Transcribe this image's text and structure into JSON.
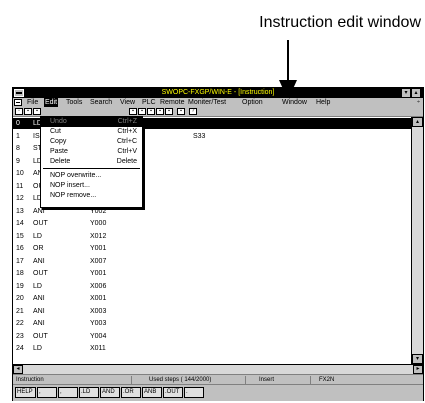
{
  "callout": {
    "label": "Instruction edit window"
  },
  "window": {
    "title": "SWOPC-FXGP/WIN-E - [Instruction]",
    "sys_menu_icon": "minus-icon",
    "title_buttons": [
      "▾",
      "▴"
    ]
  },
  "menubar": {
    "items": [
      "File",
      "Edit",
      "Tools",
      "Search",
      "View",
      "PLC",
      "Remote",
      "Moniter/Test",
      "Option",
      "Window",
      "Help"
    ],
    "active": "Edit",
    "restore_button": "÷"
  },
  "toolbar": {
    "icons": [
      "new-file-icon",
      "open-file-icon",
      "save-icon",
      "ladder-view-icon",
      "list-view-icon",
      "sfc-view-icon",
      "comment-view-icon",
      "monitor-icon",
      "zoom-icon",
      "help-icon"
    ]
  },
  "program": {
    "rows": [
      {
        "line": "0",
        "instr": "LD",
        "operand": "",
        "operand2": ""
      },
      {
        "line": "1",
        "instr": "IS",
        "operand": "S20",
        "operand2": "S33"
      },
      {
        "line": "8",
        "instr": "ST",
        "operand": "",
        "operand2": ""
      },
      {
        "line": "9",
        "instr": "LD",
        "operand": "",
        "operand2": ""
      },
      {
        "line": "10",
        "instr": "AN",
        "operand": "",
        "operand2": ""
      },
      {
        "line": "11",
        "instr": "OU",
        "operand": "",
        "operand2": ""
      },
      {
        "line": "12",
        "instr": "LD",
        "operand": "X010",
        "operand2": ""
      },
      {
        "line": "13",
        "instr": "ANI",
        "operand": "Y002",
        "operand2": ""
      },
      {
        "line": "14",
        "instr": "OUT",
        "operand": "Y000",
        "operand2": ""
      },
      {
        "line": "15",
        "instr": "LD",
        "operand": "X012",
        "operand2": ""
      },
      {
        "line": "16",
        "instr": "OR",
        "operand": "Y001",
        "operand2": ""
      },
      {
        "line": "17",
        "instr": "ANI",
        "operand": "X007",
        "operand2": ""
      },
      {
        "line": "18",
        "instr": "OUT",
        "operand": "Y001",
        "operand2": ""
      },
      {
        "line": "19",
        "instr": "LD",
        "operand": "X006",
        "operand2": ""
      },
      {
        "line": "20",
        "instr": "ANI",
        "operand": "X001",
        "operand2": ""
      },
      {
        "line": "21",
        "instr": "ANI",
        "operand": "X003",
        "operand2": ""
      },
      {
        "line": "22",
        "instr": "ANI",
        "operand": "Y003",
        "operand2": ""
      },
      {
        "line": "23",
        "instr": "OUT",
        "operand": "Y004",
        "operand2": ""
      },
      {
        "line": "24",
        "instr": "LD",
        "operand": "X011",
        "operand2": ""
      }
    ],
    "selected_index": 0
  },
  "edit_menu": {
    "items": [
      {
        "label": "Undo",
        "shortcut": "Ctrl+Z",
        "state": "highlighted"
      },
      {
        "label": "Cut",
        "shortcut": "Ctrl+X",
        "state": "enabled"
      },
      {
        "label": "Copy",
        "shortcut": "Ctrl+C",
        "state": "enabled"
      },
      {
        "label": "Paste",
        "shortcut": "Ctrl+V",
        "state": "enabled"
      },
      {
        "label": "Delete",
        "shortcut": "Delete",
        "state": "enabled"
      },
      {
        "label": "NOP overwrite...",
        "shortcut": "",
        "state": "enabled"
      },
      {
        "label": "NOP insert...",
        "shortcut": "",
        "state": "enabled"
      },
      {
        "label": "NOP remove...",
        "shortcut": "",
        "state": "enabled"
      }
    ]
  },
  "scrollbars": {
    "up": "▴",
    "down": "▾",
    "left": "◂",
    "right": "▸"
  },
  "status": {
    "mode": "Instruction",
    "steps": "Used steps ( 144/2000)",
    "edit_mode": "Insert",
    "plc_model": "FX2N"
  },
  "function_keys": [
    "HELP",
    ",",
    ",",
    ".LD",
    "AND",
    ".OR",
    "ANB",
    ".OUT",
    "."
  ]
}
